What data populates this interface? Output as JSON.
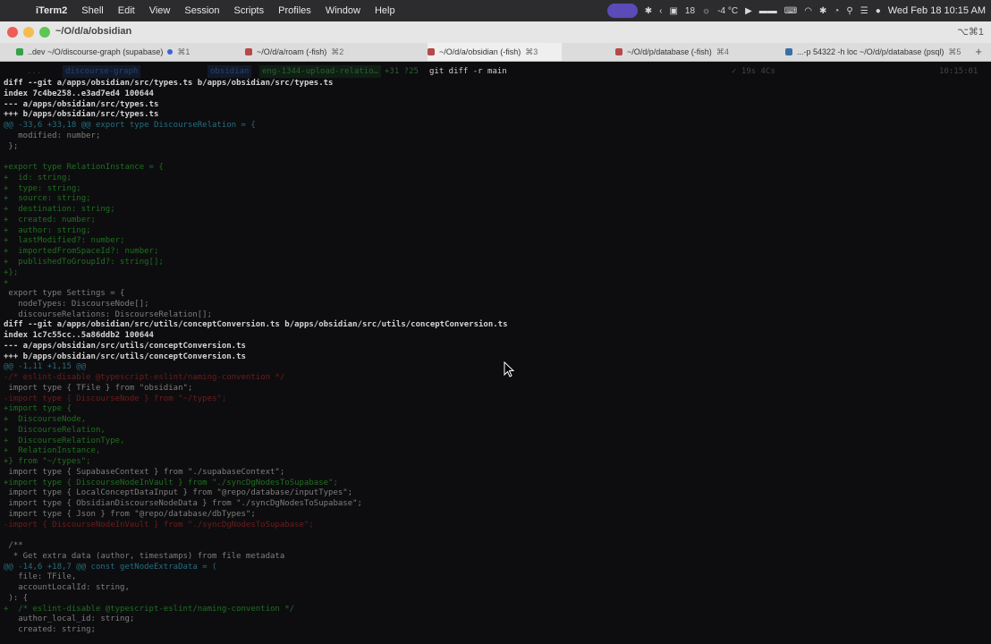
{
  "menubar": {
    "app": "iTerm2",
    "items": [
      "Shell",
      "Edit",
      "View",
      "Session",
      "Scripts",
      "Profiles",
      "Window",
      "Help"
    ],
    "temperature": "-4 °C",
    "badge": "18",
    "clock": "Wed Feb 18  10:15 AM"
  },
  "window": {
    "title": "~/O/d/a/obsidian",
    "title_shortcut": "⌥⌘1",
    "tabs": [
      {
        "label": "..dev ~/O/discourse-graph (supabase)",
        "shortcut": "⌘1",
        "color": "#35a14b"
      },
      {
        "label": "~/O/d/a/roam (-fish)",
        "shortcut": "⌘2",
        "color": "#b8474a"
      },
      {
        "label": "~/O/d/a/obsidian (-fish)",
        "shortcut": "⌘3",
        "color": "#b8474a"
      },
      {
        "label": "~/O/d/p/database (-fish)",
        "shortcut": "⌘4",
        "color": "#b8474a"
      },
      {
        "label": "...-p 54322 -h loc ~/O/d/p/database (psql)",
        "shortcut": "⌘5",
        "color": "#3a6ea8"
      }
    ],
    "new_tab": "+"
  },
  "prompt": {
    "path_dim": "...",
    "path_repo": "discourse-graph",
    "path_sub": "obsidian",
    "branch": "eng-1344-upload-relatio…",
    "branch_stats": "+31 ?25",
    "command": "git diff -r main",
    "right_status": "✓ 19s  4Cs",
    "right_time": "10:15:01"
  },
  "terminal": {
    "lines": [
      {
        "t": "meta",
        "s": "diff --git a/apps/obsidian/src/types.ts b/apps/obsidian/src/types.ts"
      },
      {
        "t": "meta",
        "s": "index 7c4be258..e3ad7ed4 100644"
      },
      {
        "t": "meta",
        "s": "--- a/apps/obsidian/src/types.ts"
      },
      {
        "t": "meta",
        "s": "+++ b/apps/obsidian/src/types.ts"
      },
      {
        "t": "hunk",
        "s": "@@ -33,6 +33,18 @@ export type DiscourseRelation = {"
      },
      {
        "t": "ctx",
        "s": "   modified: number;"
      },
      {
        "t": "ctx",
        "s": " };"
      },
      {
        "t": "ctx",
        "s": " "
      },
      {
        "t": "add",
        "s": "+export type RelationInstance = {"
      },
      {
        "t": "add",
        "s": "+  id: string;"
      },
      {
        "t": "add",
        "s": "+  type: string;"
      },
      {
        "t": "add",
        "s": "+  source: string;"
      },
      {
        "t": "add",
        "s": "+  destination: string;"
      },
      {
        "t": "add",
        "s": "+  created: number;"
      },
      {
        "t": "add",
        "s": "+  author: string;"
      },
      {
        "t": "add",
        "s": "+  lastModified?: number;"
      },
      {
        "t": "add",
        "s": "+  importedFromSpaceId?: number;"
      },
      {
        "t": "add",
        "s": "+  publishedToGroupId?: string[];"
      },
      {
        "t": "add",
        "s": "+};"
      },
      {
        "t": "add",
        "s": "+"
      },
      {
        "t": "ctx",
        "s": " export type Settings = {"
      },
      {
        "t": "ctx",
        "s": "   nodeTypes: DiscourseNode[];"
      },
      {
        "t": "ctx",
        "s": "   discourseRelations: DiscourseRelation[];"
      },
      {
        "t": "meta",
        "s": "diff --git a/apps/obsidian/src/utils/conceptConversion.ts b/apps/obsidian/src/utils/conceptConversion.ts"
      },
      {
        "t": "meta",
        "s": "index 1c7c55cc..5a86ddb2 100644"
      },
      {
        "t": "meta",
        "s": "--- a/apps/obsidian/src/utils/conceptConversion.ts"
      },
      {
        "t": "meta",
        "s": "+++ b/apps/obsidian/src/utils/conceptConversion.ts"
      },
      {
        "t": "hunk",
        "s": "@@ -1,11 +1,15 @@"
      },
      {
        "t": "del",
        "s": "-/* eslint-disable @typescript-eslint/naming-convention */"
      },
      {
        "t": "ctx",
        "s": " import type { TFile } from \"obsidian\";"
      },
      {
        "t": "del",
        "s": "-import type { DiscourseNode } from \"~/types\";"
      },
      {
        "t": "add",
        "s": "+import type {"
      },
      {
        "t": "add",
        "s": "+  DiscourseNode,"
      },
      {
        "t": "add",
        "s": "+  DiscourseRelation,"
      },
      {
        "t": "add",
        "s": "+  DiscourseRelationType,"
      },
      {
        "t": "add",
        "s": "+  RelationInstance,"
      },
      {
        "t": "add",
        "s": "+} from \"~/types\";"
      },
      {
        "t": "ctx",
        "s": " import type { SupabaseContext } from \"./supabaseContext\";"
      },
      {
        "t": "add",
        "s": "+import type { DiscourseNodeInVault } from \"./syncDgNodesToSupabase\";"
      },
      {
        "t": "ctx",
        "s": " import type { LocalConceptDataInput } from \"@repo/database/inputTypes\";"
      },
      {
        "t": "ctx",
        "s": " import type { ObsidianDiscourseNodeData } from \"./syncDgNodesToSupabase\";"
      },
      {
        "t": "ctx",
        "s": " import type { Json } from \"@repo/database/dbTypes\";"
      },
      {
        "t": "del",
        "s": "-import { DiscourseNodeInVault } from \"./syncDgNodesToSupabase\";"
      },
      {
        "t": "ctx",
        "s": " "
      },
      {
        "t": "ctx",
        "s": " /**"
      },
      {
        "t": "ctx",
        "s": "  * Get extra data (author, timestamps) from file metadata"
      },
      {
        "t": "hunk",
        "s": "@@ -14,6 +18,7 @@ const getNodeExtraData = ("
      },
      {
        "t": "ctx",
        "s": "   file: TFile,"
      },
      {
        "t": "ctx",
        "s": "   accountLocalId: string,"
      },
      {
        "t": "ctx",
        "s": " ): {"
      },
      {
        "t": "add",
        "s": "+  /* eslint-disable @typescript-eslint/naming-convention */"
      },
      {
        "t": "ctx",
        "s": "   author_local_id: string;"
      },
      {
        "t": "ctx",
        "s": "   created: string;"
      }
    ]
  },
  "colors": {
    "meta": "#d4d4d4",
    "hunk": "#256d7f",
    "context": "#7e7e7e",
    "added": "#1f6f1f",
    "deleted": "#6e1c1c"
  }
}
